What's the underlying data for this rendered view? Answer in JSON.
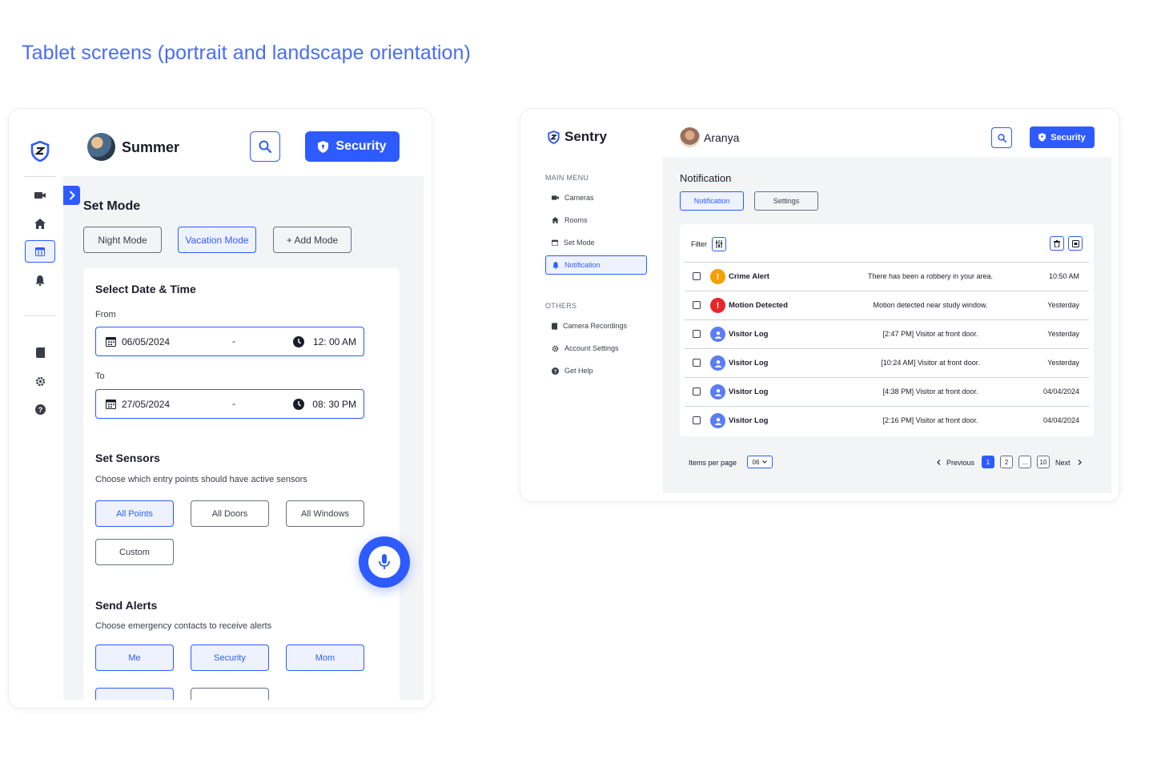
{
  "heading": "Tablet screens (portrait and landscape orientation)",
  "portrait": {
    "user_name": "Summer",
    "security_button": "Security",
    "set_mode_title": "Set Mode",
    "modes": [
      {
        "label": "Night Mode",
        "selected": false
      },
      {
        "label": "Vacation Mode",
        "selected": true
      },
      {
        "label": "+ Add Mode",
        "selected": false
      }
    ],
    "date_time": {
      "title": "Select Date & Time",
      "from_label": "From",
      "from_date": "06/05/2024",
      "from_time": "12: 00 AM",
      "to_label": "To",
      "to_date": "27/05/2024",
      "to_time": "08: 30 PM",
      "separator": "-"
    },
    "sensors": {
      "title": "Set Sensors",
      "subtitle": "Choose which entry points should have active sensors",
      "options": [
        {
          "label": "All Points",
          "selected": true
        },
        {
          "label": "All Doors",
          "selected": false
        },
        {
          "label": "All Windows",
          "selected": false
        },
        {
          "label": "Custom",
          "selected": false
        }
      ]
    },
    "alerts": {
      "title": "Send  Alerts",
      "subtitle": "Choose emergency contacts to receive alerts",
      "contacts": [
        "Me",
        "Security",
        "Mom"
      ]
    },
    "rail_icons": [
      "camera-icon",
      "home-icon",
      "calendar-icon",
      "bell-icon",
      "recordings-icon",
      "gear-icon",
      "help-icon"
    ]
  },
  "landscape": {
    "brand": "Sentry",
    "user_name": "Aranya",
    "security_button": "Security",
    "main_menu_label": "MAIN MENU",
    "main_menu": [
      {
        "label": "Cameras",
        "icon": "camera-icon",
        "active": false
      },
      {
        "label": "Rooms",
        "icon": "home-icon",
        "active": false
      },
      {
        "label": "Set Mode",
        "icon": "calendar-icon",
        "active": false
      },
      {
        "label": "Notification",
        "icon": "bell-icon",
        "active": true
      }
    ],
    "others_label": "OTHERS",
    "others_menu": [
      {
        "label": "Camera Recordings",
        "icon": "recordings-icon"
      },
      {
        "label": "Account Settings",
        "icon": "gear-icon"
      },
      {
        "label": "Get Help",
        "icon": "help-icon"
      }
    ],
    "page_title": "Notification",
    "tabs": [
      {
        "label": "Notification",
        "active": true
      },
      {
        "label": "Settings",
        "active": false
      }
    ],
    "filter_label": "Filter",
    "notifications": [
      {
        "type": "warning",
        "title": "Crime Alert",
        "message": "There has been a robbery in your area.",
        "time": "10:50 AM"
      },
      {
        "type": "danger",
        "title": "Motion Detected",
        "message": "Motion detected near study window.",
        "time": "Yesterday"
      },
      {
        "type": "visitor",
        "title": "Visitor Log",
        "message": "[2:47 PM] Visitor at front door.",
        "time": "Yesterday"
      },
      {
        "type": "visitor",
        "title": "Visitor Log",
        "message": "[10:24 AM] Visitor at front door.",
        "time": "Yesterday"
      },
      {
        "type": "visitor",
        "title": "Visitor Log",
        "message": "[4:38 PM] Visitor at front door.",
        "time": "04/04/2024"
      },
      {
        "type": "visitor",
        "title": "Visitor Log",
        "message": "[2:16 PM] Visitor at front door.",
        "time": "04/04/2024"
      }
    ],
    "items_per_page_label": "Items per page",
    "items_per_page": "06",
    "pagination": {
      "previous": "Previous",
      "next": "Next",
      "pages": [
        "1",
        "2",
        "...",
        "10"
      ],
      "current": "1"
    }
  },
  "colors": {
    "accent": "#2e5bff",
    "heading": "#4a6cf7",
    "warning": "#f5a000",
    "danger": "#e8262c",
    "visitor": "#5b7cf7",
    "surface": "#f3f4f6"
  }
}
